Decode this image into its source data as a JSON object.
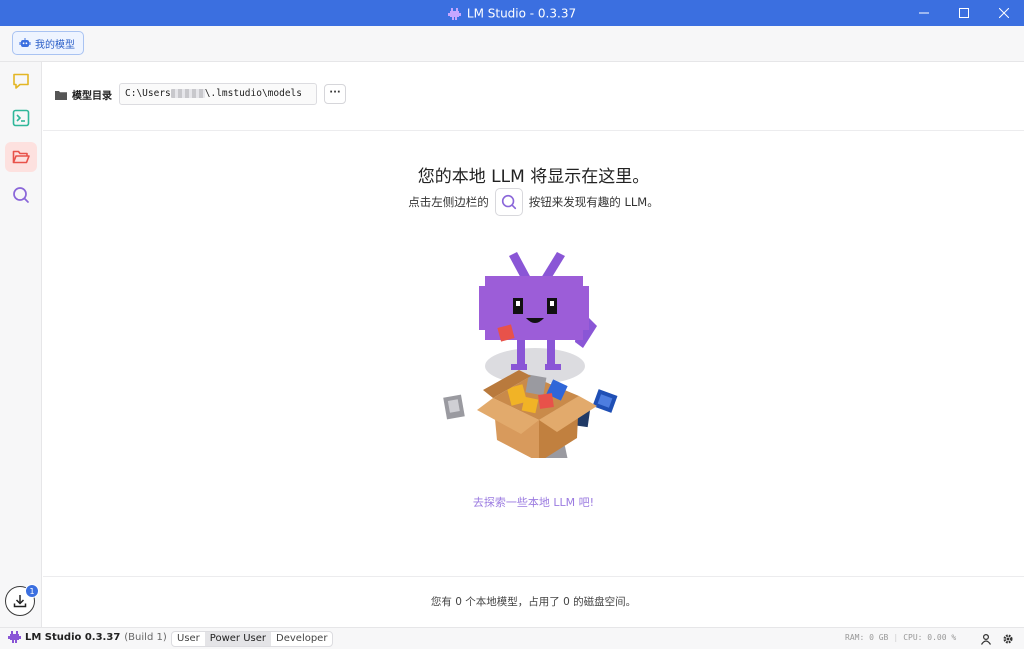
{
  "window": {
    "title": "LM Studio - 0.3.37"
  },
  "toolbar": {
    "my_models_label": "我的模型"
  },
  "sidebar": {
    "items": [
      {
        "name": "chat",
        "icon": "chat-bubble-icon",
        "color": "#e3b624"
      },
      {
        "name": "developer",
        "icon": "terminal-icon",
        "color": "#2fb79a"
      },
      {
        "name": "my-models",
        "icon": "folder-open-icon",
        "color": "#e8524a",
        "active": true
      },
      {
        "name": "discover",
        "icon": "search-icon",
        "color": "#8a66d9"
      }
    ],
    "downloads_badge": "1"
  },
  "models_dir": {
    "label": "模型目录",
    "path_prefix": "C:\\Users",
    "path_suffix": "\\.lmstudio\\models",
    "more_label": "···"
  },
  "empty_state": {
    "headline": "您的本地 LLM 将显示在这里。",
    "sub_before": "点击左侧边栏的",
    "sub_after": "按钮来发现有趣的 LLM。",
    "explore_link": "去探索一些本地 LLM 吧!"
  },
  "footer_info": "您有 0 个本地模型，占用了 0 的磁盘空间。",
  "statusbar": {
    "app_name": "LM Studio 0.3.37",
    "build": "(Build 1)",
    "modes": [
      "User",
      "Power User",
      "Developer"
    ],
    "active_mode": "Power User",
    "ram": "RAM: 0 GB",
    "cpu": "CPU: 0.00 %"
  },
  "colors": {
    "titlebar": "#3b6fe0",
    "accent_purple": "#8a56d6",
    "active_sidebar_bg": "#fde1df"
  }
}
